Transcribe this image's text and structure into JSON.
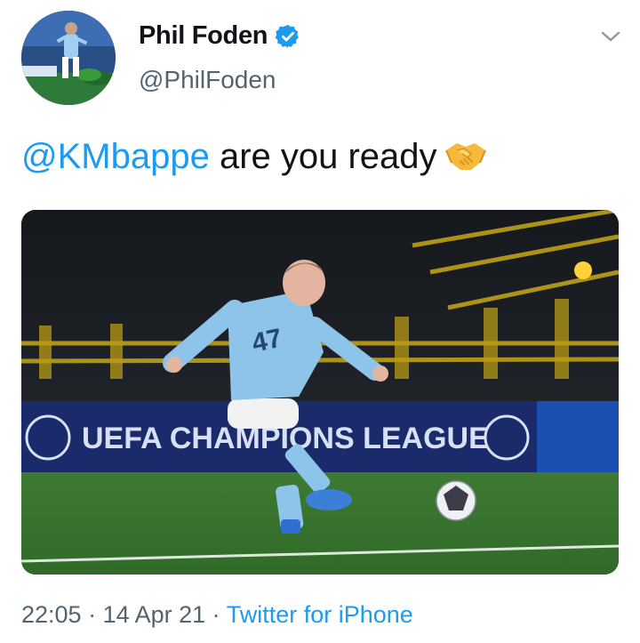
{
  "author": {
    "display_name": "Phil Foden",
    "handle": "@PhilFoden",
    "verified": true,
    "avatar_icon": "profile-photo"
  },
  "tweet": {
    "mention": "@KMbappe",
    "text": " are you ready",
    "emoji": "handshake-emoji"
  },
  "media": {
    "banner_text": "UEFA CHAMPIONS LEAGUE",
    "jersey_number": "47"
  },
  "meta": {
    "time": "22:05",
    "separator": " · ",
    "date": "14 Apr 21",
    "source": "Twitter for iPhone"
  },
  "colors": {
    "link": "#1d9bf0",
    "secondary_text": "#536471",
    "verified_badge": "#1d9bf0",
    "kit_sky_blue": "#8ec3ea"
  }
}
